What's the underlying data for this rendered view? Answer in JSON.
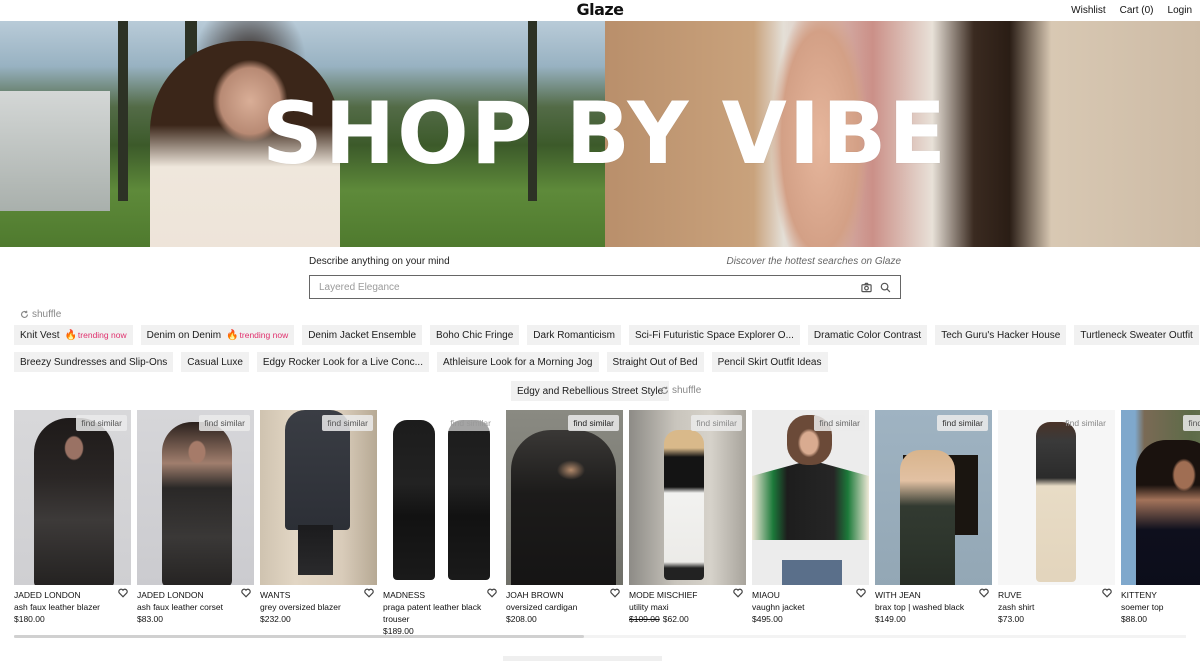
{
  "header": {
    "logo": "Glaze",
    "nav": [
      {
        "label": "Wishlist"
      },
      {
        "label": "Cart (0)"
      },
      {
        "label": "Login"
      }
    ]
  },
  "hero": {
    "title": "SHOP BY VIBE"
  },
  "search": {
    "label": "Describe anything on your mind",
    "discover_link": "Discover the hottest searches on Glaze",
    "placeholder": "Layered Elegance",
    "value": "",
    "icons": [
      "camera-icon",
      "search-icon"
    ]
  },
  "shuffle_label": "shuffle",
  "chips": {
    "row1": [
      {
        "label": "Knit Vest",
        "trending": "trending now"
      },
      {
        "label": "Denim on Denim",
        "trending": "trending now"
      },
      {
        "label": "Denim Jacket Ensemble"
      },
      {
        "label": "Boho Chic Fringe"
      },
      {
        "label": "Dark Romanticism"
      },
      {
        "label": "Sci-Fi Futuristic Space Explorer O..."
      },
      {
        "label": "Dramatic Color Contrast"
      },
      {
        "label": "Tech Guru's Hacker House"
      },
      {
        "label": "Turtleneck Sweater Outfit"
      }
    ],
    "row2": [
      {
        "label": "Breezy Sundresses and Slip-Ons"
      },
      {
        "label": "Casual Luxe"
      },
      {
        "label": "Edgy Rocker Look for a Live Conc..."
      },
      {
        "label": "Athleisure Look for a Morning Jog"
      },
      {
        "label": "Straight Out of Bed"
      },
      {
        "label": "Pencil Skirt Outfit Ideas"
      }
    ],
    "row3": [
      {
        "label": "Edgy and Rebellious Street Style"
      }
    ]
  },
  "find_similar_label": "find similar",
  "products": [
    {
      "brand": "JADED LONDON",
      "name": "ash faux leather blazer",
      "price": "$180.00"
    },
    {
      "brand": "JADED LONDON",
      "name": "ash faux leather corset",
      "price": "$83.00"
    },
    {
      "brand": "WANTS",
      "name": "grey oversized blazer",
      "price": "$232.00"
    },
    {
      "brand": "MADNESS",
      "name": "praga patent leather black trouser",
      "price": "$189.00"
    },
    {
      "brand": "JOAH BROWN",
      "name": "oversized cardigan",
      "price": "$208.00"
    },
    {
      "brand": "MODE MISCHIEF",
      "name": "utility maxi",
      "old_price": "$109.00",
      "price": "$62.00"
    },
    {
      "brand": "MIAOU",
      "name": "vaughn jacket",
      "price": "$495.00"
    },
    {
      "brand": "WITH JEAN",
      "name": "brax top | washed black",
      "price": "$149.00"
    },
    {
      "brand": "RUVE",
      "name": "zash shirt",
      "price": "$73.00"
    },
    {
      "brand": "KITTENY",
      "name": "soemer top",
      "price": "$88.00"
    }
  ],
  "carousel_scroll_progress": 0.0
}
